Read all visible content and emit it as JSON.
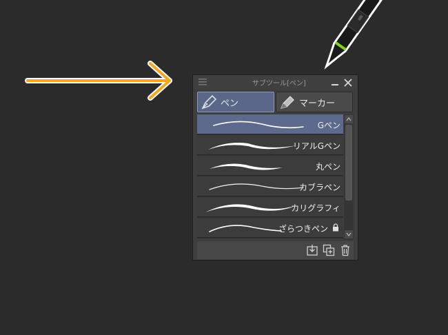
{
  "panel": {
    "title": "サブツール[ペン]",
    "tabs": [
      {
        "label": "ペン",
        "icon": "pen-nib-icon",
        "active": true
      },
      {
        "label": "マーカー",
        "icon": "marker-icon",
        "active": false
      }
    ],
    "brushes": [
      {
        "label": "Gペン",
        "selected": true,
        "locked": false
      },
      {
        "label": "リアルGペン",
        "selected": false,
        "locked": false
      },
      {
        "label": "丸ペン",
        "selected": false,
        "locked": false
      },
      {
        "label": "カブラペン",
        "selected": false,
        "locked": false
      },
      {
        "label": "カリグラフィ",
        "selected": false,
        "locked": false
      },
      {
        "label": "ざらつきペン",
        "selected": false,
        "locked": true
      }
    ],
    "footer_icons": [
      "copy-to-tool-icon",
      "duplicate-icon",
      "trash-icon"
    ]
  },
  "colors": {
    "background": "#2b2b2b",
    "arrow": "#f5a623",
    "selection": "#5d6a8d",
    "stylus_ring": "#7ed321"
  }
}
